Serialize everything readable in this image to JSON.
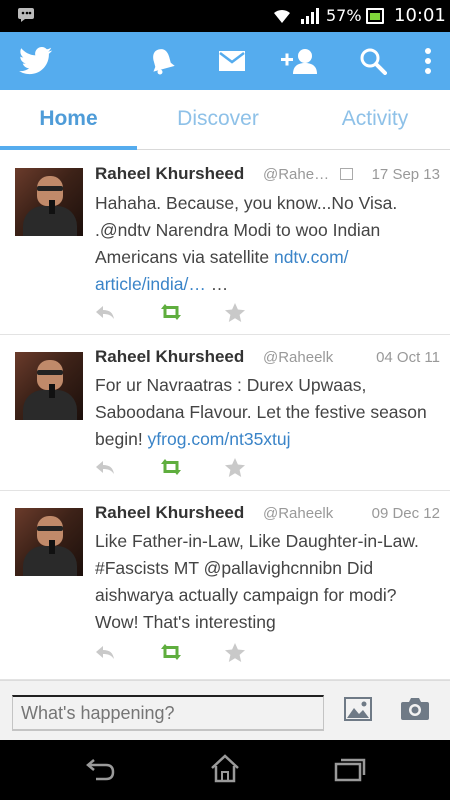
{
  "status_bar": {
    "battery_percent": "57%",
    "battery_level": 0.57,
    "time": "10:01",
    "icons": [
      "bbm-icon",
      "wifi-icon",
      "signal-icon",
      "battery-icon"
    ]
  },
  "action_bar": {
    "brand_color": "#55acee",
    "icons": [
      "twitter-bird-icon",
      "notifications-bell-icon",
      "messages-envelope-icon",
      "add-user-icon",
      "search-icon",
      "overflow-menu-icon"
    ]
  },
  "tabs": [
    {
      "label": "Home",
      "active": true
    },
    {
      "label": "Discover",
      "active": false
    },
    {
      "label": "Activity",
      "active": false
    }
  ],
  "tweets": [
    {
      "name": "Raheel Khursheed",
      "handle": "@Rahe…",
      "date": "17 Sep 13",
      "text_parts": [
        {
          "t": "Hahaha. Because, you know...No Visa. .@ndtv Narendra Modi to woo Indian Americans via satellite ",
          "link": false
        },
        {
          "t": "ndtv.com/ article/india/…",
          "link": true
        },
        {
          "t": " …",
          "link": false
        }
      ]
    },
    {
      "name": "Raheel Khursheed",
      "handle": "@Raheelk",
      "date": "04 Oct 11",
      "text_parts": [
        {
          "t": "For ur Navraatras : Durex Upwaas, Saboodana Flavour. Let the festive season begin! ",
          "link": false
        },
        {
          "t": "yfrog.com/nt35xtuj",
          "link": true
        }
      ]
    },
    {
      "name": "Raheel Khursheed",
      "handle": "@Raheelk",
      "date": "09 Dec 12",
      "text_parts": [
        {
          "t": "Like Father-in-Law, Like Daughter-in-Law. #Fascists MT @pallavighcnnibn Did aishwarya actually campaign for modi? Wow! That's interesting",
          "link": false
        }
      ]
    }
  ],
  "tweet_actions": [
    "reply-icon",
    "retweet-icon",
    "favorite-star-icon"
  ],
  "compose": {
    "placeholder": "What's happening?",
    "icons": [
      "photo-icon",
      "camera-icon"
    ]
  },
  "nav_bar": {
    "icons": [
      "back-icon",
      "home-icon",
      "recent-apps-icon"
    ]
  },
  "colors": {
    "link": "#3a84c8",
    "retweet_green": "#5fae3e",
    "tab_active": "#4f9cd8",
    "tab_inactive": "#8ec1e8"
  }
}
